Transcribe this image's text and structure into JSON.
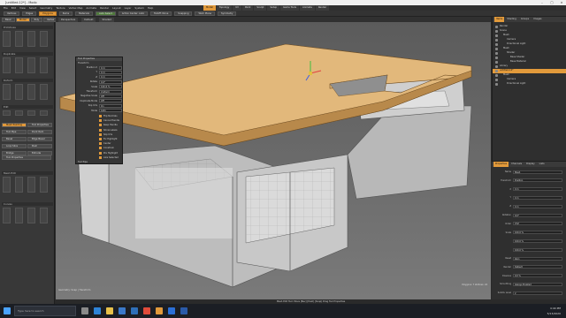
{
  "window": {
    "title": "[untitled-12*] - Modo"
  },
  "menu": [
    "File",
    "Edit",
    "View",
    "Select",
    "Geometry",
    "Texture",
    "Vertex Map",
    "Animate",
    "Render",
    "Layout",
    "Layer",
    "System",
    "Help"
  ],
  "layout_tabs": [
    {
      "label": "Model"
    },
    {
      "label": "Topology"
    },
    {
      "label": "UV"
    },
    {
      "label": "Paint"
    },
    {
      "label": "Sculpt"
    },
    {
      "label": "Setup"
    },
    {
      "label": "Game Tools"
    },
    {
      "label": "Animate"
    },
    {
      "label": "Render"
    }
  ],
  "toolbar": {
    "mode_buttons": [
      "Vertices",
      "Edges",
      "Polygons",
      "Items",
      "Materials"
    ],
    "actions": [
      "Auto Select",
      "Action Center: Auto",
      "Falloff: None",
      "Snapping",
      "Work Plane",
      "Symmetry"
    ]
  },
  "left_panel": {
    "tool_tabs": [
      "Basic",
      "Model",
      "Poly",
      "Vertex"
    ],
    "sections": [
      "Primitives",
      "Duplicate",
      "Deform",
      "Edit",
      "Mesh Edit",
      "Curves"
    ],
    "buttons": [
      "Mesh Painting",
      "Tool Properties",
      "Tool Pipe",
      "Dock Item",
      "Bevel",
      "Edge Bevel",
      "Loop Slice",
      "Push",
      "Bridge",
      "Extrude"
    ],
    "tool_properties_label": "Tool Properties"
  },
  "viewport": {
    "tabs": [
      "Perspective",
      "Default",
      "Shaded"
    ],
    "status": "Geometry: Snap | Transform",
    "info": "Polygons: 7 Vertices: 24"
  },
  "tool_props": {
    "title": "Tool Properties",
    "header": "Transform",
    "rows": [
      {
        "label": "Position X",
        "value": "0 m"
      },
      {
        "label": "Y",
        "value": "0 m"
      },
      {
        "label": "Z",
        "value": "0 m"
      },
      {
        "label": "Rotate",
        "value": "0.0°"
      },
      {
        "label": "Scale",
        "value": "100.0 %"
      },
      {
        "label": "Transform",
        "value": "Uniform"
      },
      {
        "label": "Negative Scale",
        "value": "Off"
      },
      {
        "label": "Duplicate Mode",
        "value": "Off"
      },
      {
        "label": "Slip UVs",
        "value": "On"
      },
      {
        "label": "Mode",
        "value": "Auto"
      }
    ],
    "checks": [
      "Flip Normals",
      "Cancel Handle",
      "Keep Handle",
      "Show Labels",
      "Slip UVs",
      "Fix Highlight",
      "Center",
      "Constrain",
      "Pre Highlight",
      "Axis Selected"
    ],
    "footer": "Tool Pipe"
  },
  "items": {
    "tabs": [
      "Items",
      "Shading",
      "Groups",
      "Images"
    ],
    "list": [
      {
        "name": "Render"
      },
      {
        "name": "Scene"
      },
      {
        "name": "Mesh"
      },
      {
        "name": "Camera"
      },
      {
        "name": "Directional Light"
      },
      {
        "name": "Mesh"
      },
      {
        "name": "Shader"
      },
      {
        "name": "Base Shader"
      },
      {
        "name": "Base Material"
      },
      {
        "name": "Library"
      },
      {
        "name": "untitled-12*"
      },
      {
        "name": "Mesh"
      },
      {
        "name": "Camera"
      },
      {
        "name": "Directional Light"
      }
    ],
    "selected_index": 10
  },
  "properties": {
    "tabs": [
      "Properties",
      "Channels",
      "Display",
      "Lists"
    ],
    "rows": [
      {
        "label": "Name",
        "value": "Mesh"
      },
      {
        "label": "Transform",
        "value": "Position"
      },
      {
        "label": "X",
        "value": "0 m"
      },
      {
        "label": "Y",
        "value": "0 m"
      },
      {
        "label": "Z",
        "value": "0 m"
      },
      {
        "label": "Rotation",
        "value": "0.0°"
      },
      {
        "label": "Order",
        "value": "XYZ"
      },
      {
        "label": "Scale",
        "value": "100.0 %"
      },
      {
        "label": "",
        "value": "100.0 %"
      },
      {
        "label": "",
        "value": "100.0 %"
      },
      {
        "label": "Reset",
        "value": "Zero"
      },
      {
        "label": "Render",
        "value": "Default"
      },
      {
        "label": "Dissolve",
        "value": "0.0 %"
      },
      {
        "label": "Smoothing",
        "value": "Always Enabled"
      },
      {
        "label": "Subdiv Level",
        "value": "2"
      }
    ]
  },
  "statusbar": {
    "text": "Mesh Edit  Tool: Move  [Bev] [Push] [Snap]  Drag  Tool Properties"
  },
  "taskbar": {
    "search_placeholder": "Type here to search",
    "time": "4:44 PM",
    "date": "5/13/2020",
    "apps": [
      {
        "icon": "windows-icon",
        "color": "#4aa3ff"
      },
      {
        "icon": "task-view-icon",
        "color": "#8a8a8a"
      },
      {
        "icon": "edge-icon",
        "color": "#2e83d6"
      },
      {
        "icon": "explorer-icon",
        "color": "#e8c14a"
      },
      {
        "icon": "store-icon",
        "color": "#3a78c9"
      },
      {
        "icon": "mail-icon",
        "color": "#2f6fb8"
      },
      {
        "icon": "chrome-icon",
        "color": "#e04b3a"
      },
      {
        "icon": "modo-icon",
        "color": "#e29a3b"
      },
      {
        "icon": "photoshop-icon",
        "color": "#2b6fd6"
      },
      {
        "icon": "word-icon",
        "color": "#2a5aa8"
      }
    ]
  }
}
